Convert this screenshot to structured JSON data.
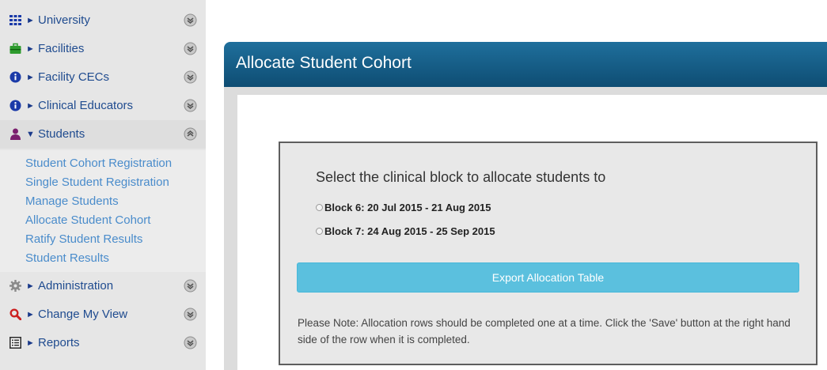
{
  "sidebar": {
    "items": [
      {
        "label": "University",
        "icon": "grid-icon",
        "arrow": "►",
        "expanded": false
      },
      {
        "label": "Facilities",
        "icon": "briefcase-icon",
        "arrow": "►",
        "expanded": false
      },
      {
        "label": "Facility CECs",
        "icon": "info-icon",
        "arrow": "►",
        "expanded": false
      },
      {
        "label": "Clinical Educators",
        "icon": "info-icon",
        "arrow": "►",
        "expanded": false
      },
      {
        "label": "Students",
        "icon": "user-icon",
        "arrow": "▼",
        "expanded": true
      },
      {
        "label": "Administration",
        "icon": "gear-icon",
        "arrow": "►",
        "expanded": false
      },
      {
        "label": "Change My View",
        "icon": "magnifier-icon",
        "arrow": "►",
        "expanded": false
      },
      {
        "label": "Reports",
        "icon": "list-icon",
        "arrow": "►",
        "expanded": false
      }
    ],
    "students_submenu": [
      "Student Cohort Registration",
      "Single Student Registration",
      "Manage Students",
      "Allocate Student Cohort",
      "Ratify Student Results",
      "Student Results"
    ]
  },
  "panel": {
    "title": "Allocate Student Cohort",
    "prompt": "Select the clinical block to allocate students to",
    "blocks": [
      {
        "label": "Block 6: 20 Jul 2015 - 21 Aug 2015",
        "selected": false
      },
      {
        "label": "Block 7: 24 Aug 2015 - 25 Sep 2015",
        "selected": false
      }
    ],
    "export_label": "Export Allocation Table",
    "note": "Please Note: Allocation rows should be completed one at a time. Click the 'Save' button at the right hand side of the row when it is completed."
  },
  "colors": {
    "header": "#0e4d73",
    "button": "#5bc0de",
    "link": "#4a8ccb",
    "user_icon": "#7b1f6e",
    "briefcase_icon": "#2e9b2e",
    "magnifier_icon": "#cc2222"
  }
}
